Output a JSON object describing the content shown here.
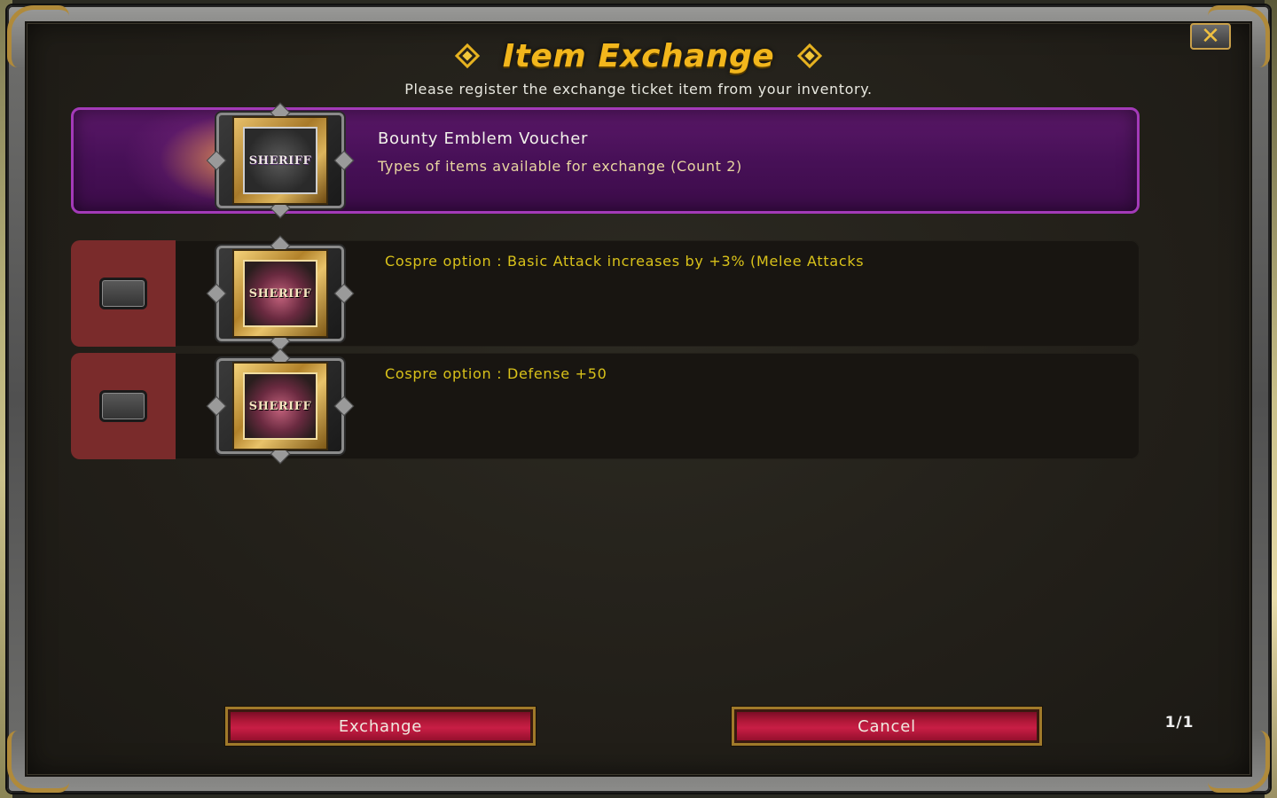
{
  "dialog": {
    "title": "Item Exchange",
    "subtitle": "Please register the exchange ticket item from your inventory.",
    "close_symbol": "✕"
  },
  "voucher": {
    "name": "Bounty Emblem Voucher",
    "description": "Types of items available for exchange (Count 2)",
    "icon": "sheriff-badge-icon",
    "icon_label": "SHERIFF"
  },
  "options": [
    {
      "text": "Cospre option : Basic Attack increases by +3% (Melee Attacks",
      "icon": "sheriff-badge-icon",
      "icon_label": "SHERIFF",
      "checked": false
    },
    {
      "text": "Cospre option : Defense +50",
      "icon": "sheriff-badge-icon",
      "icon_label": "SHERIFF",
      "checked": false
    }
  ],
  "buttons": {
    "exchange": "Exchange",
    "cancel": "Cancel"
  },
  "pagination": "1/1",
  "colors": {
    "title": "#f2b61c",
    "option_text": "#d9c21a",
    "voucher_bg": "#471057",
    "voucher_border": "#a33ab8",
    "check_cell": "#7a2b2b",
    "button_red": "#c81e45",
    "gold_trim": "#a07a2a"
  }
}
